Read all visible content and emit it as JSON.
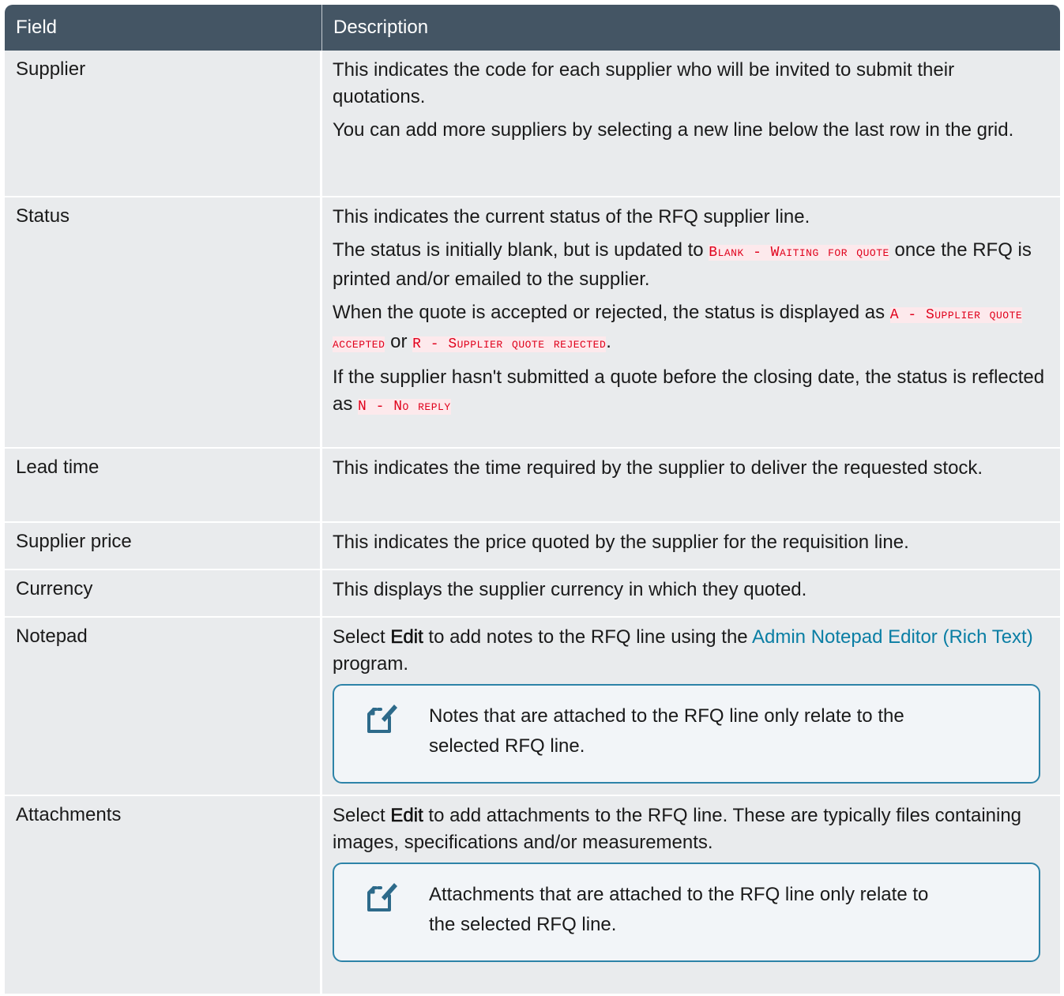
{
  "header": {
    "field_label": "Field",
    "description_label": "Description"
  },
  "rows": {
    "supplier": {
      "field": "Supplier",
      "p1": "This indicates the code for each supplier who will be invited to submit their quotations.",
      "p2": "You can add more suppliers by selecting a new line below the last row in the grid."
    },
    "status": {
      "field": "Status",
      "p1": "This indicates the current status of the RFQ supplier line.",
      "p2_before": "The status is initially blank, but is updated to ",
      "p2_code": "Blank - Waiting for quote",
      "p2_after": " once the RFQ is printed and/or emailed to the supplier.",
      "p3_before": "When the quote is accepted or rejected, the status is displayed as ",
      "p3_code1": "A - Supplier quote accepted",
      "p3_mid": " or ",
      "p3_code2": "R - Supplier quote rejected",
      "p3_after": ".",
      "p4_before": "If the supplier hasn't submitted a quote before the closing date, the status is reflected as ",
      "p4_code": "N - No reply"
    },
    "lead_time": {
      "field": "Lead time",
      "p1": "This indicates the time required by the supplier to deliver the requested stock."
    },
    "supplier_price": {
      "field": "Supplier price",
      "p1": "This indicates the price quoted by the supplier for the requisition line."
    },
    "currency": {
      "field": "Currency",
      "p1": "This displays the supplier currency in which they quoted."
    },
    "notepad": {
      "field": "Notepad",
      "p1_before": "Select ",
      "p1_bold": "Edit",
      "p1_mid": " to add notes to the RFQ line using the ",
      "p1_link": "Admin Notepad Editor (Rich Text)",
      "p1_after": " program.",
      "note": "Notes that are attached to the RFQ line only relate to the selected RFQ line."
    },
    "attachments": {
      "field": "Attachments",
      "p1_before": "Select ",
      "p1_bold": "Edit",
      "p1_after": " to add attachments to the RFQ line. These are typically files containing images, specifications and/or measurements.",
      "note": "Attachments that are attached to the RFQ line only relate to the selected RFQ line."
    }
  },
  "icons": {
    "note": "note-edit-icon"
  },
  "colors": {
    "header_bg": "#445564",
    "row_bg": "#e9ebed",
    "code_text": "#e0001b",
    "code_bg": "#fde9ec",
    "link": "#0a7ea4",
    "note_border": "#2d83a8"
  }
}
